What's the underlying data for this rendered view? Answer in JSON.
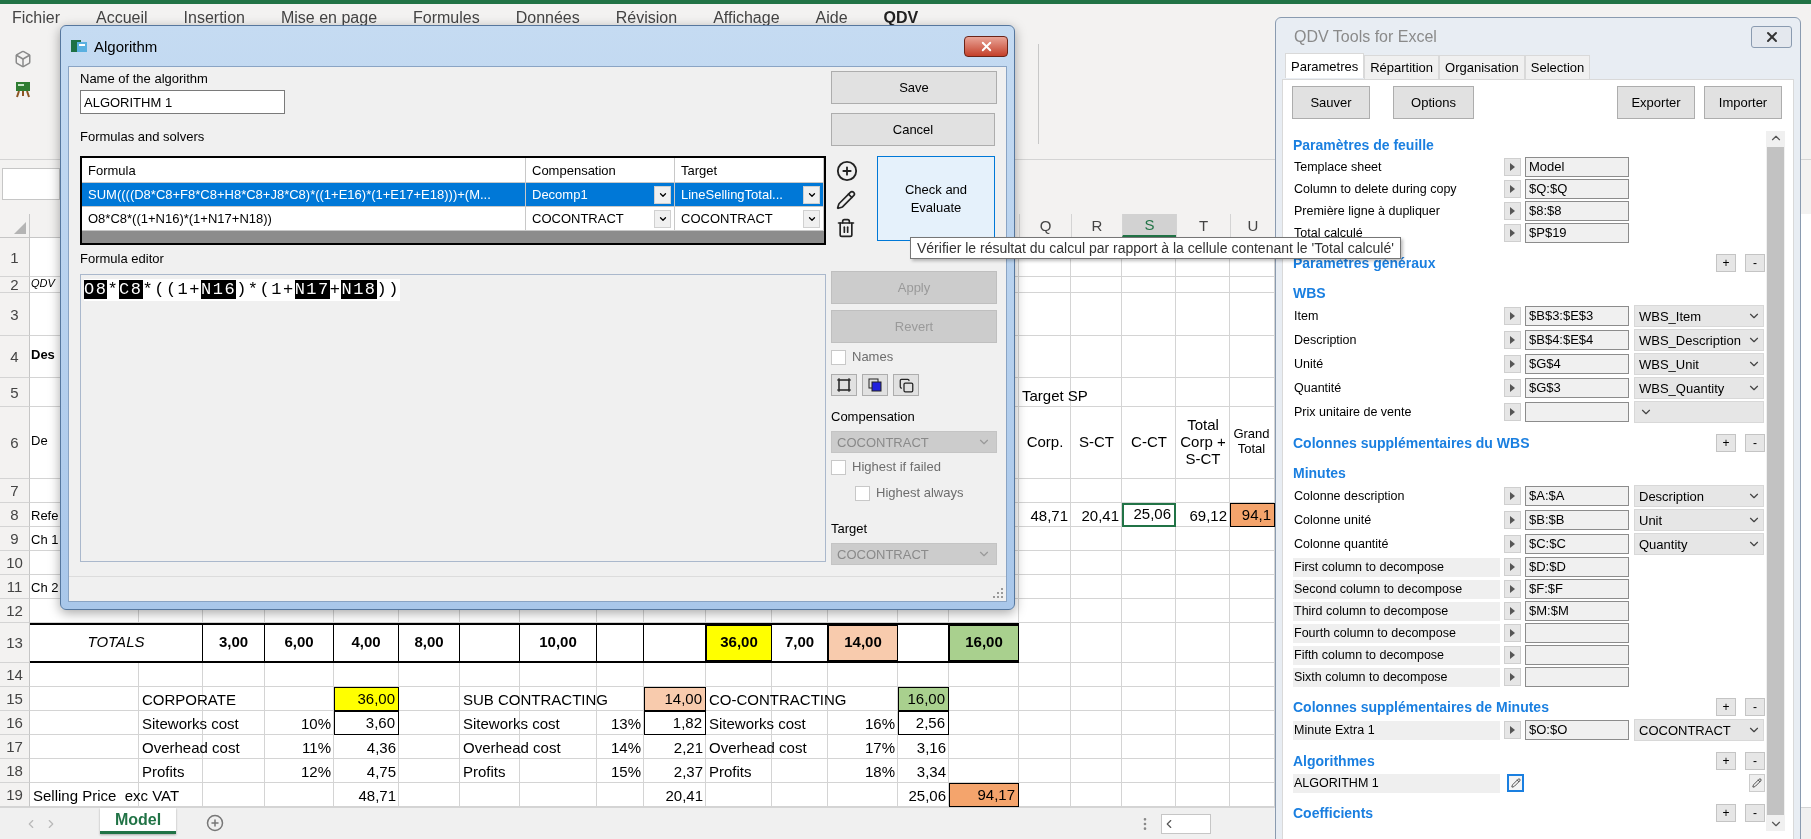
{
  "excel": {
    "ribbon_tabs": [
      {
        "label": "Fichier",
        "selected": false
      },
      {
        "label": "Accueil",
        "selected": false
      },
      {
        "label": "Insertion",
        "selected": false
      },
      {
        "label": "Mise en page",
        "selected": false
      },
      {
        "label": "Formules",
        "selected": false
      },
      {
        "label": "Données",
        "selected": false
      },
      {
        "label": "Révision",
        "selected": false
      },
      {
        "label": "Affichage",
        "selected": false
      },
      {
        "label": "Aide",
        "selected": false
      },
      {
        "label": "QDV",
        "selected": true
      }
    ],
    "column_headers": [
      {
        "label": "Q",
        "selected": false
      },
      {
        "label": "R",
        "selected": false
      },
      {
        "label": "S",
        "selected": true
      },
      {
        "label": "T",
        "selected": false
      },
      {
        "label": "U",
        "selected": false
      }
    ],
    "rows": [
      {
        "number": "1"
      },
      {
        "number": "2",
        "cells": [
          {
            "text": "QDV",
            "kind": "caption",
            "selected": false
          }
        ]
      },
      {
        "number": "3"
      },
      {
        "number": "4",
        "cells": [
          {
            "text": "Des",
            "kind": "bold",
            "selected": false
          }
        ]
      },
      {
        "number": "5",
        "cells": [
          {
            "text": "Target SP",
            "kind": "text",
            "selected": false
          }
        ]
      },
      {
        "number": "6",
        "cells": [
          {
            "text": "De",
            "kind": "middle",
            "selected": false
          },
          {
            "text": "Corp.",
            "kind": "center",
            "selected": false
          },
          {
            "text": "S-CT",
            "kind": "center",
            "selected": false
          },
          {
            "text": "C-CT",
            "kind": "center",
            "selected": false
          },
          {
            "text": "Total Corp + S-CT",
            "kind": "wrap",
            "selected": false
          },
          {
            "text": "Grand Total",
            "kind": "wrap",
            "selected": false
          }
        ]
      },
      {
        "number": "7"
      },
      {
        "number": "8",
        "cells": [
          {
            "text": "Refe",
            "kind": "text",
            "selected": false
          },
          {
            "text": "48,71",
            "kind": "number",
            "selected": false
          },
          {
            "text": "20,41",
            "kind": "number",
            "selected": false
          },
          {
            "text": "25,06",
            "kind": "number",
            "selected": true
          },
          {
            "text": "69,12",
            "kind": "number",
            "selected": false
          },
          {
            "text": "94,1",
            "kind": "number",
            "selected": false,
            "color": "#f4a46c"
          }
        ]
      },
      {
        "number": "9",
        "cells": [
          {
            "text": "Ch 1",
            "kind": "text",
            "selected": false
          }
        ]
      },
      {
        "number": "10"
      },
      {
        "number": "11",
        "cells": [
          {
            "text": "Ch 2",
            "kind": "text",
            "selected": false
          }
        ]
      },
      {
        "number": "12"
      },
      {
        "number": "13",
        "kind": "totals",
        "cells": [
          {
            "text": "TOTALS",
            "kind": "totals-label",
            "selected": false
          },
          {
            "text": "3,00",
            "kind": "totals",
            "selected": false
          },
          {
            "text": "6,00",
            "kind": "totals",
            "selected": false
          },
          {
            "text": "4,00",
            "kind": "totals",
            "selected": false
          },
          {
            "text": "8,00",
            "kind": "totals",
            "selected": false
          },
          {
            "text": "10,00",
            "kind": "totals",
            "selected": false
          },
          {
            "text": "36,00",
            "kind": "totals",
            "selected": false,
            "color": "#ffff00"
          },
          {
            "text": "7,00",
            "kind": "totals",
            "selected": false
          },
          {
            "text": "14,00",
            "kind": "totals",
            "selected": false,
            "color": "#f8cbad"
          },
          {
            "text": "16,00",
            "kind": "totals",
            "selected": false,
            "color": "#a9d08e"
          }
        ]
      },
      {
        "number": "14"
      },
      {
        "number": "15",
        "cells": [
          {
            "text": "CORPORATE",
            "kind": "text",
            "selected": false
          },
          {
            "text": "36,00",
            "kind": "number",
            "selected": false,
            "color": "#ffff00"
          },
          {
            "text": "SUB CONTRACTING",
            "kind": "text",
            "selected": false
          },
          {
            "text": "14,00",
            "kind": "number",
            "selected": false,
            "color": "#f8cbad"
          },
          {
            "text": "CO-CONTRACTING",
            "kind": "text",
            "selected": false
          },
          {
            "text": "16,00",
            "kind": "number",
            "selected": false,
            "color": "#a9d08e"
          }
        ]
      },
      {
        "number": "16",
        "cells": [
          {
            "text": "Siteworks cost",
            "kind": "text",
            "selected": false
          },
          {
            "text": "10%",
            "kind": "number",
            "selected": false
          },
          {
            "text": "3,60",
            "kind": "boxed",
            "selected": false
          },
          {
            "text": "Siteworks cost",
            "kind": "text",
            "selected": false
          },
          {
            "text": "13%",
            "kind": "number",
            "selected": false
          },
          {
            "text": "1,82",
            "kind": "boxed",
            "selected": false
          },
          {
            "text": "Siteworks cost",
            "kind": "text",
            "selected": false
          },
          {
            "text": "16%",
            "kind": "number",
            "selected": false
          },
          {
            "text": "2,56",
            "kind": "boxed",
            "selected": false
          }
        ]
      },
      {
        "number": "17",
        "cells": [
          {
            "text": "Overhead cost",
            "kind": "text",
            "selected": false
          },
          {
            "text": "11%",
            "kind": "number",
            "selected": false
          },
          {
            "text": "4,36",
            "kind": "number",
            "selected": false
          },
          {
            "text": "Overhead cost",
            "kind": "text",
            "selected": false
          },
          {
            "text": "14%",
            "kind": "number",
            "selected": false
          },
          {
            "text": "2,21",
            "kind": "number",
            "selected": false
          },
          {
            "text": "Overhead cost",
            "kind": "text",
            "selected": false
          },
          {
            "text": "17%",
            "kind": "number",
            "selected": false
          },
          {
            "text": "3,16",
            "kind": "number",
            "selected": false
          }
        ]
      },
      {
        "number": "18",
        "cells": [
          {
            "text": "Profits",
            "kind": "text",
            "selected": false
          },
          {
            "text": "12%",
            "kind": "number",
            "selected": false
          },
          {
            "text": "4,75",
            "kind": "number",
            "selected": false
          },
          {
            "text": "Profits",
            "kind": "text",
            "selected": false
          },
          {
            "text": "15%",
            "kind": "number",
            "selected": false
          },
          {
            "text": "2,37",
            "kind": "number",
            "selected": false
          },
          {
            "text": "Profits",
            "kind": "text",
            "selected": false
          },
          {
            "text": "18%",
            "kind": "number",
            "selected": false
          },
          {
            "text": "3,34",
            "kind": "number",
            "selected": false
          }
        ]
      },
      {
        "number": "19",
        "cells": [
          {
            "text": "Selling Price  exc VAT",
            "kind": "text",
            "selected": false
          },
          {
            "text": "48,71",
            "kind": "number",
            "selected": false
          },
          {
            "text": "20,41",
            "kind": "number",
            "selected": false
          },
          {
            "text": "25,06",
            "kind": "number",
            "selected": false
          },
          {
            "text": "94,17",
            "kind": "number",
            "selected": false,
            "color": "#f4a46c"
          }
        ]
      }
    ],
    "sheet_tabs": [
      {
        "label": "Model",
        "selected": true
      }
    ]
  },
  "algorithm_dialog": {
    "title": "Algorithm",
    "name_label": "Name of the algorithm",
    "name_value": "ALGORITHM 1",
    "formulas_label": "Formulas and solvers",
    "columns": [
      "Formula",
      "Compensation",
      "Target"
    ],
    "rows": [
      {
        "formula": "SUM((((D8*C8+F8*C8+H8*C8+J8*C8)*((1+E16)*(1+E17+E18)))+(M...",
        "compensation": "Decomp1",
        "target": "LineSellingTotal...",
        "selected": true
      },
      {
        "formula": "O8*C8*((1+N16)*(1+N17+N18))",
        "compensation": "COCONTRACT",
        "target": "COCONTRACT",
        "selected": false
      }
    ],
    "save": "Save",
    "cancel": "Cancel",
    "check": "Check and Evaluate",
    "editor_label": "Formula editor",
    "formula_tokens": [
      {
        "text": "O8",
        "kind": "ref"
      },
      {
        "text": "*",
        "kind": "op"
      },
      {
        "text": "C8",
        "kind": "ref"
      },
      {
        "text": "*((1+",
        "kind": "op"
      },
      {
        "text": "N16",
        "kind": "ref"
      },
      {
        "text": ")*(1+",
        "kind": "op"
      },
      {
        "text": "N17",
        "kind": "ref"
      },
      {
        "text": "+",
        "kind": "op"
      },
      {
        "text": "N18",
        "kind": "ref"
      },
      {
        "text": "))",
        "kind": "op"
      }
    ],
    "apply": {
      "label": "Apply",
      "disabled": true
    },
    "revert": {
      "label": "Revert",
      "disabled": true
    },
    "names": {
      "label": "Names",
      "checked": false,
      "disabled": true
    },
    "compensation_label": "Compensation",
    "compensation_select": {
      "value": "COCONTRACT",
      "disabled": true
    },
    "highest_if_failed": {
      "label": "Highest if failed",
      "checked": false,
      "disabled": true
    },
    "highest_always": {
      "label": "Highest always",
      "checked": false,
      "disabled": true
    },
    "target_label": "Target",
    "target_select": {
      "value": "COCONTRACT",
      "disabled": true
    }
  },
  "tooltip": "Vérifier le résultat du calcul par rapport à la cellule contenant le 'Total calculé'",
  "qdv_panel": {
    "title": "QDV Tools for Excel",
    "tabs": [
      {
        "label": "Parametres",
        "selected": true
      },
      {
        "label": "Répartition",
        "selected": false
      },
      {
        "label": "Organisation",
        "selected": false
      },
      {
        "label": "Selection",
        "selected": false
      }
    ],
    "buttons": [
      "Sauver",
      "Options",
      "Exporter",
      "Importer"
    ],
    "sections": [
      {
        "title": "Paramètres de feuille",
        "rows": [
          {
            "kind": "plain",
            "label": "Templace sheet",
            "value": "Model"
          },
          {
            "kind": "plain",
            "label": "Column to delete during copy",
            "value": "$Q:$Q"
          },
          {
            "kind": "plain",
            "label": "Première ligne à dupliquer",
            "value": "$8:$8"
          },
          {
            "kind": "plain",
            "label": "Total calculé",
            "value": "$P$19"
          }
        ]
      },
      {
        "title": "Paramètres généraux",
        "actions": [
          "+",
          "-"
        ]
      },
      {
        "title": "WBS",
        "rows": [
          {
            "kind": "plain",
            "label": "Item",
            "value": "$B$3:$E$3",
            "select": "WBS_Item"
          },
          {
            "kind": "plain",
            "label": "Description",
            "value": "$B$4:$E$4",
            "select": "WBS_Description"
          },
          {
            "kind": "plain",
            "label": "Unité",
            "value": "$G$4",
            "select": "WBS_Unit"
          },
          {
            "kind": "plain",
            "label": "Quantité",
            "value": "$G$3",
            "select": "WBS_Quantity"
          },
          {
            "kind": "plain",
            "label": "Prix unitaire de vente",
            "select": null
          }
        ]
      },
      {
        "title": "Colonnes supplémentaires du WBS",
        "actions": [
          "+",
          "-"
        ]
      },
      {
        "title": "Minutes",
        "rows": [
          {
            "kind": "plain",
            "label": "Colonne description",
            "value": "$A:$A",
            "select": "Description"
          },
          {
            "kind": "plain",
            "label": "Colonne unité",
            "value": "$B:$B",
            "select": "Unit"
          },
          {
            "kind": "plain",
            "label": "Colonne quantité",
            "value": "$C:$C",
            "select": "Quantity"
          },
          {
            "kind": "shaded",
            "label": "First column to decompose",
            "value": "$D:$D"
          },
          {
            "kind": "shaded",
            "label": "Second column to decompose",
            "value": "$F:$F"
          },
          {
            "kind": "shaded",
            "label": "Third column to decompose",
            "value": "$M:$M"
          },
          {
            "kind": "shaded",
            "label": "Fourth column to decompose"
          },
          {
            "kind": "shaded",
            "label": "Fifth column to decompose"
          },
          {
            "kind": "shaded",
            "label": "Sixth column to decompose"
          }
        ]
      },
      {
        "title": "Colonnes supplémentaires de Minutes",
        "actions": [
          "+",
          "-"
        ],
        "rows": [
          {
            "kind": "shaded",
            "label": "Minute Extra 1",
            "value": "$O:$O",
            "select": "COCONTRACT"
          }
        ]
      },
      {
        "title": "Algorithmes",
        "actions": [
          "+",
          "-"
        ],
        "rows": [
          {
            "kind": "algorithm",
            "label": "ALGORITHM 1"
          }
        ]
      },
      {
        "title": "Coefficients",
        "actions": [
          "+",
          "-"
        ]
      }
    ]
  }
}
